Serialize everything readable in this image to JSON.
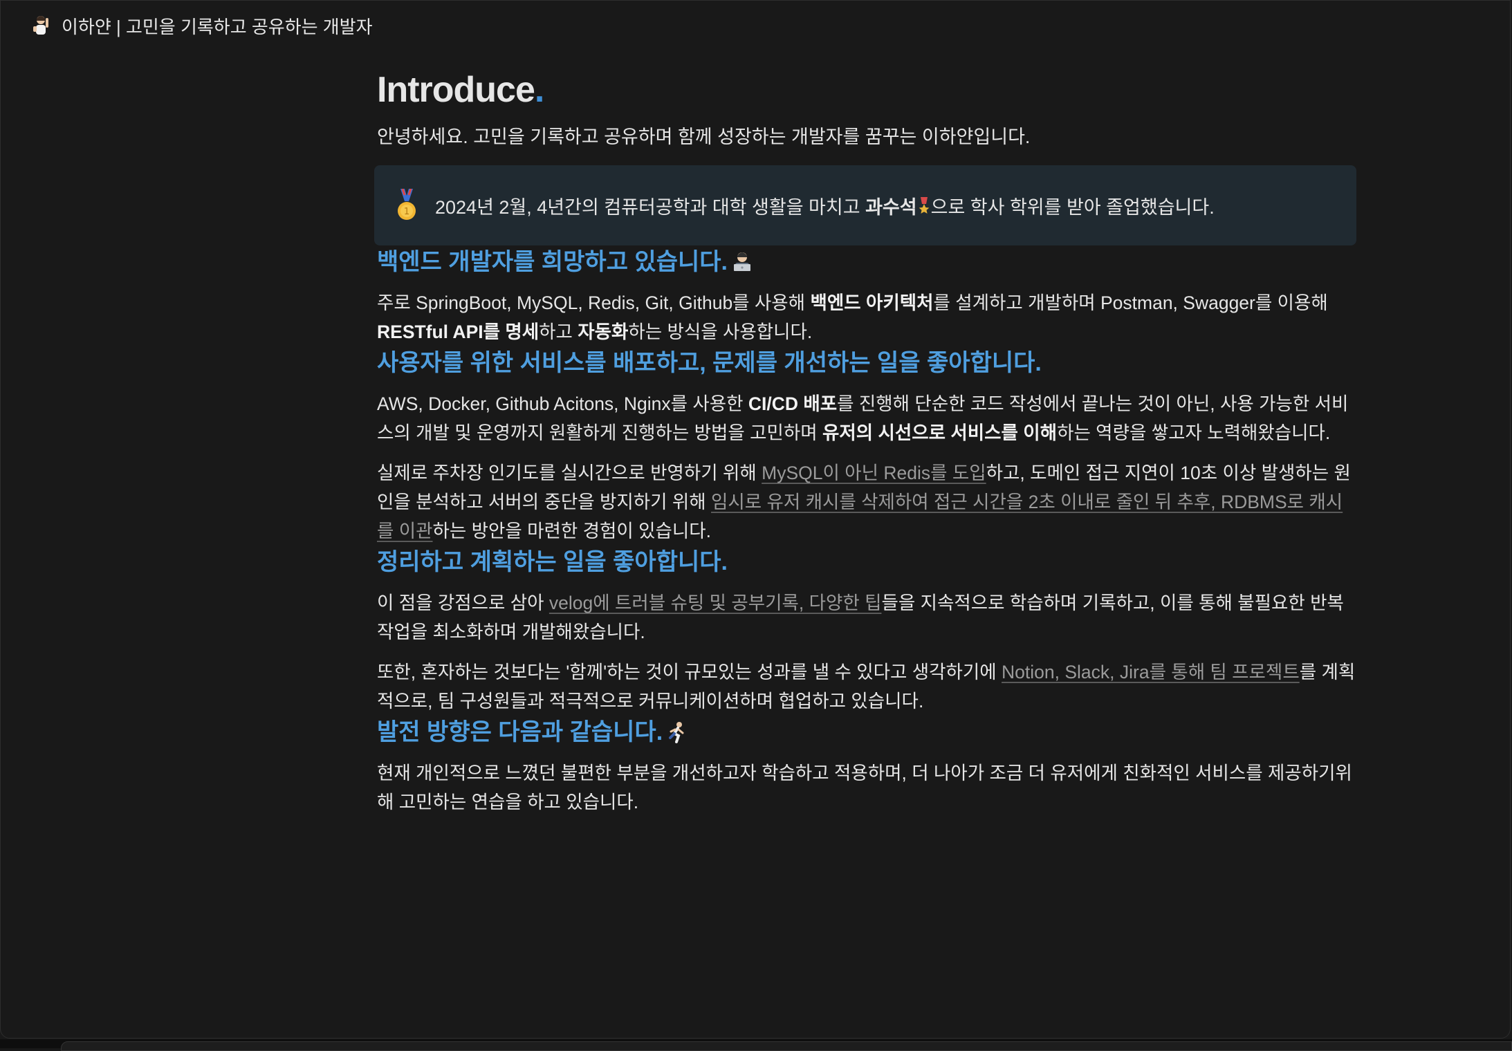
{
  "site": {
    "title": "이하얀 | 고민을 기록하고 공유하는 개발자"
  },
  "header": {
    "title": "Introduce",
    "dot": "."
  },
  "intro": "안녕하세요. 고민을 기록하고 공유하며 함께 성장하는 개발자를 꿈꾸는 이하얀입니다.",
  "callout": {
    "pre": "2024년 2월, 4년간의 컴퓨터공학과 대학 생활을 마치고 ",
    "bold": "과수석",
    "post": "으로 학사 학위를 받아 졸업했습니다."
  },
  "sections": {
    "backend": {
      "heading": "백엔드 개발자를 희망하고 있습니다.",
      "p1": {
        "t1": "주로 SpringBoot, MySQL, Redis, Git, Github를 사용해 ",
        "b1": "백엔드 아키텍처",
        "t2": "를 설계하고 개발하며 Postman, Swagger를 이용해 ",
        "b2": "RESTful API를 명세",
        "t3": "하고 ",
        "b3": "자동화",
        "t4": "하는 방식을 사용합니다."
      }
    },
    "service": {
      "heading": "사용자를 위한 서비스를 배포하고, 문제를 개선하는 일을 좋아합니다.",
      "p1": {
        "t1": "AWS, Docker, Github Acitons, Nginx를 사용한 ",
        "b1": "CI/CD 배포",
        "t2": "를 진행해 단순한 코드 작성에서 끝나는 것이 아닌, 사용 가능한 서비스의 개발 및 운영까지 원활하게 진행하는 방법을 고민하며 ",
        "b2": "유저의 시선으로 서비스를 이해",
        "t3": "하는 역량을 쌓고자 노력해왔습니다."
      },
      "p2": {
        "t1": "실제로 주차장 인기도를 실시간으로 반영하기 위해 ",
        "l1": "MySQL이 아닌 Redis를 도입",
        "t2": "하고, 도메인 접근 지연이 10초 이상 발생하는 원인을 분석하고 서버의 중단을 방지하기 위해 ",
        "l2": "임시로 유저 캐시를 삭제하여 접근 시간을 2초 이내로 줄인 뒤 추후, RDBMS로 캐시를 이관",
        "t3": "하는 방안을 마련한 경험이 있습니다."
      }
    },
    "organize": {
      "heading": "정리하고 계획하는 일을 좋아합니다.",
      "p1": {
        "t1": "이 점을 강점으로 삼아 ",
        "l1": "velog에 트러블 슈팅 및 공부기록, 다양한 팁",
        "t2": "들을 지속적으로 학습하며 기록하고, 이를 통해 불필요한 반복작업을 최소화하며 개발해왔습니다."
      },
      "p2": {
        "t1": "또한, 혼자하는 것보다는 '함께'하는 것이  규모있는 성과를 낼 수 있다고 생각하기에 ",
        "l1": "Notion, Slack, Jira를 통해 팀 프로젝트",
        "t2": "를 계획적으로, 팀 구성원들과 적극적으로 커뮤니케이션하며 협업하고 있습니다."
      }
    },
    "growth": {
      "heading": "발전 방향은 다음과 같습니다.",
      "p1": "현재 개인적으로 느꼈던 불편한 부분을 개선하고자 학습하고 적용하며, 더 나아가 조금 더 유저에게 친화적인 서비스를 제공하기위해 고민하는 연습을 하고 있습니다."
    }
  },
  "icons": {
    "avatar": "person-raising-hand-icon",
    "medal": "first-place-medal-icon",
    "ribbon": "military-medal-icon",
    "laptop": "technologist-icon",
    "runner": "runner-icon"
  },
  "colors": {
    "accent": "#4f9fe0",
    "background": "#191919",
    "callout": "#202a31"
  }
}
